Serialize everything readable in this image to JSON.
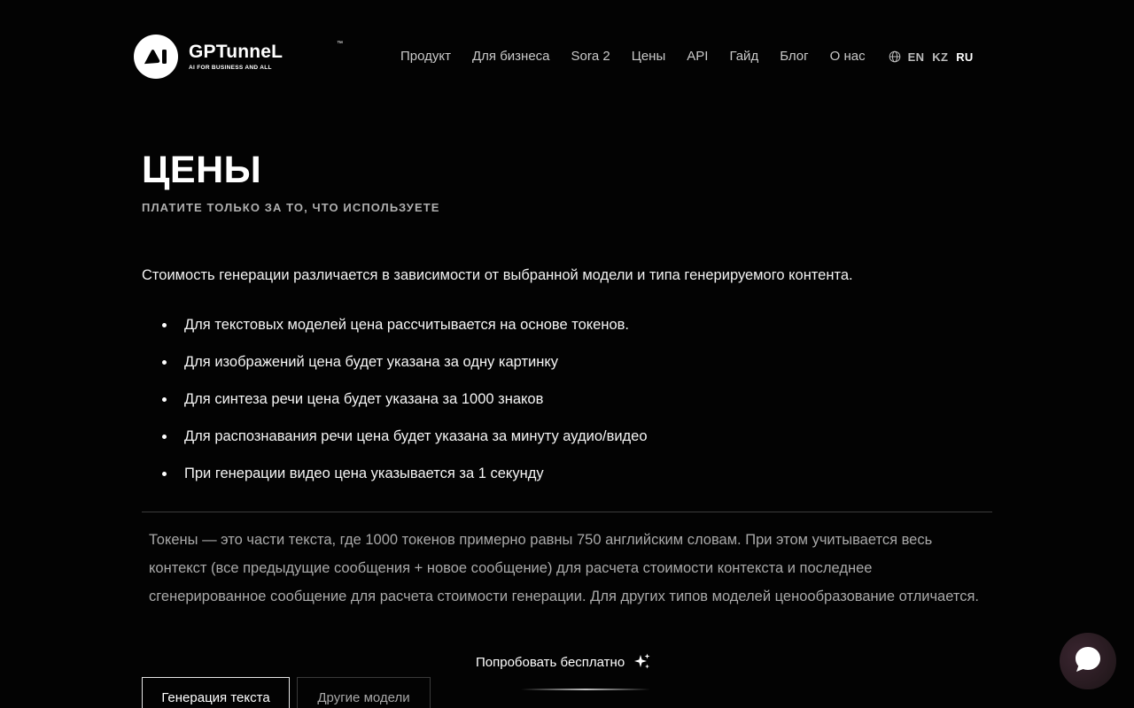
{
  "header": {
    "logo": {
      "name": "GPTunneL",
      "trademark": "™",
      "tagline": "AI FOR BUSINESS AND ALL",
      "mark_text": "AI"
    },
    "nav": [
      {
        "label": "Продукт"
      },
      {
        "label": "Для бизнеса"
      },
      {
        "label": "Sora 2"
      },
      {
        "label": "Цены"
      },
      {
        "label": "API"
      },
      {
        "label": "Гайд"
      },
      {
        "label": "Блог"
      },
      {
        "label": "О нас"
      }
    ],
    "languages": [
      {
        "code": "EN",
        "active": false
      },
      {
        "code": "KZ",
        "active": false
      },
      {
        "code": "RU",
        "active": true
      }
    ]
  },
  "main": {
    "title": "ЦЕНЫ",
    "subtitle": "ПЛАТИТЕ ТОЛЬКО ЗА ТО, ЧТО ИСПОЛЬЗУЕТЕ",
    "intro": "Стоимость генерации различается в зависимости от выбранной модели и типа генерируемого контента.",
    "bullets": [
      "Для текстовых моделей цена рассчитывается на основе токенов.",
      "Для изображений цена будет указана за одну картинку",
      "Для синтеза речи цена будет указана за 1000 знаков",
      "Для распознавания речи цена будет указана за минуту аудио/видео",
      "При генерации видео цена указывается за 1 секунду"
    ],
    "note": "Токены — это части текста, где 1000 токенов примерно равны 750 английским словам. При этом учитывается весь контекст (все предыдущие сообщения + новое сообщение) для расчета стоимости контекста и последнее сгенерированное сообщение для расчета стоимости генерации. Для других типов моделей ценообразование отличается.",
    "tabs": [
      {
        "label": "Генерация текста",
        "active": true
      },
      {
        "label": "Другие модели",
        "active": false
      }
    ]
  },
  "cta": {
    "label": "Попробовать бесплатно",
    "icon": "sparkles-icon"
  },
  "chat_widget": {
    "icon": "chat-bubble-icon"
  },
  "colors": {
    "background": "#030303",
    "text": "#ffffff",
    "muted_text": "#a9a9a9",
    "divider": "#3c3c3c"
  }
}
